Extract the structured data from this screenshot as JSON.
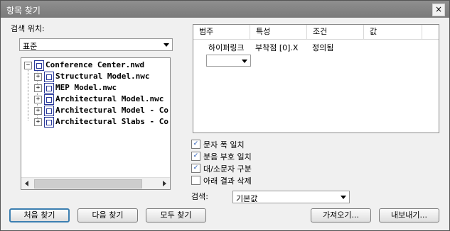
{
  "window": {
    "title": "항목 찾기",
    "close_label": "×"
  },
  "search_location": {
    "label": "검색 위치:",
    "selected": "표준"
  },
  "tree": {
    "root": "Conference Center.nwd",
    "children": [
      "Structural Model.nwc",
      "MEP Model.nwc",
      "Architectural Model.nwc",
      "Architectural Model - Co",
      "Architectural Slabs - Co"
    ]
  },
  "grid": {
    "headers": [
      "범주",
      "특성",
      "조건",
      "값"
    ],
    "row": {
      "category": "하이퍼링크",
      "property": "부착점 [0].X",
      "condition": "정의됨",
      "value": ""
    }
  },
  "options": {
    "match_width": {
      "label": "문자 폭 일치",
      "checked": true
    },
    "match_diacritics": {
      "label": "분음 부호 일치",
      "checked": true
    },
    "match_case": {
      "label": "대/소문자 구분",
      "checked": true
    },
    "prune_below": {
      "label": "아래 결과 삭제",
      "checked": false
    }
  },
  "search_mode": {
    "label": "검색:",
    "selected": "기본값"
  },
  "buttons": {
    "find_first": "처음 찾기",
    "find_next": "다음 찾기",
    "find_all": "모두 찾기",
    "import": "가져오기...",
    "export": "내보내기..."
  },
  "icons": {
    "checkmark": "✓",
    "expand": "+",
    "collapse": "−"
  }
}
